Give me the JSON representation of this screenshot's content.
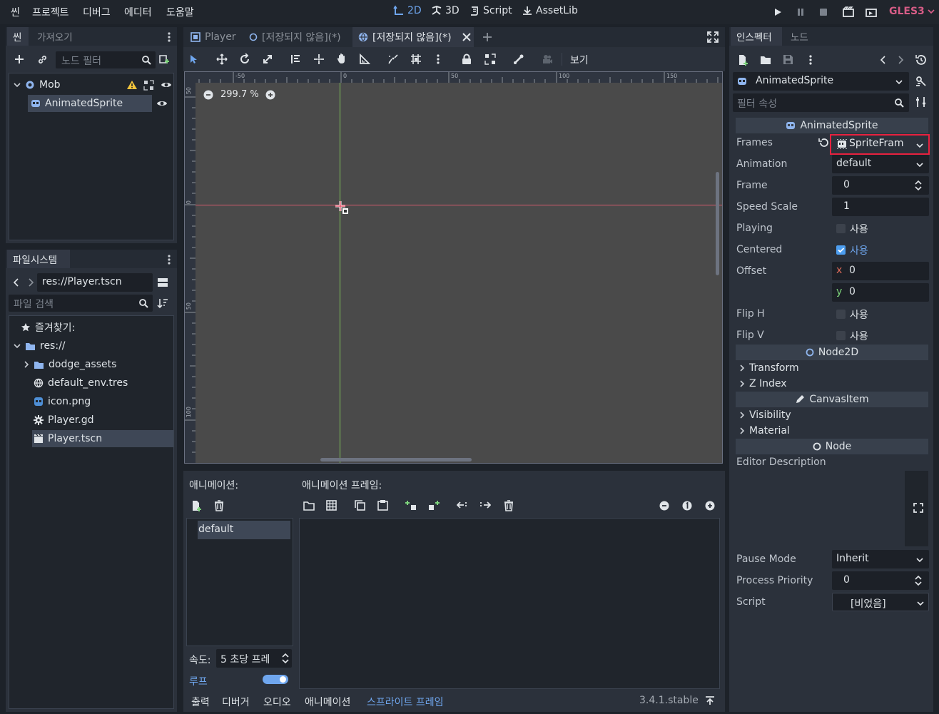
{
  "menu": [
    "씬",
    "프로젝트",
    "디버그",
    "에디터",
    "도움말"
  ],
  "workspaces": [
    {
      "label": "2D",
      "icon": "2d-icon"
    },
    {
      "label": "3D",
      "icon": "3d-icon"
    },
    {
      "label": "Script",
      "icon": "script-icon"
    },
    {
      "label": "AssetLib",
      "icon": "assetlib-icon"
    }
  ],
  "renderer": "GLES3",
  "scene_dock": {
    "tabs": [
      "씬",
      "가져오기"
    ],
    "filter_placeholder": "노드 필터",
    "tree": [
      {
        "label": "Mob",
        "icon": "node2d-icon"
      },
      {
        "label": "AnimatedSprite",
        "icon": "animated-sprite-icon"
      }
    ]
  },
  "filesystem": {
    "tab": "파일시스템",
    "path": "res://Player.tscn",
    "search_placeholder": "파일 검색",
    "favorites": "즐겨찾기:",
    "root": "res://",
    "items": [
      {
        "label": "dodge_assets",
        "icon": "folder-icon"
      },
      {
        "label": "default_env.tres",
        "icon": "environment-icon"
      },
      {
        "label": "icon.png",
        "icon": "image-icon"
      },
      {
        "label": "Player.gd",
        "icon": "gear-icon"
      },
      {
        "label": "Player.tscn",
        "icon": "scene-icon"
      }
    ]
  },
  "editor_tabs": [
    "Player",
    "[저장되지 않음](*)",
    "[저장되지 않음](*)"
  ],
  "toolbar": {
    "view_label": "보기"
  },
  "viewport": {
    "zoom": "299.7 %",
    "ruler_h": [
      "-50",
      "0",
      "50",
      "100",
      "150"
    ],
    "ruler_v": [
      "50",
      "0",
      "50",
      "100"
    ]
  },
  "sprite_frames_panel": {
    "animations_label": "애니메이션:",
    "frames_label": "애니메이션 프레임:",
    "animation_list": [
      "default"
    ],
    "speed_label": "속도:",
    "speed_value": "5 초당 프레",
    "loop_label": "루프",
    "loop_on": true
  },
  "bottom_tabs": [
    "출력",
    "디버거",
    "오디오",
    "애니메이션",
    "스프라이트 프레임"
  ],
  "version": "3.4.1.stable",
  "inspector": {
    "tabs": [
      "인스펙터",
      "노드"
    ],
    "object_name": "AnimatedSprite",
    "filter_placeholder": "필터 속성",
    "class_header": "AnimatedSprite",
    "properties": {
      "frames_label": "Frames",
      "frames_value": "SpriteFram",
      "animation_label": "Animation",
      "animation_value": "default",
      "frame_label": "Frame",
      "frame_value": "0",
      "speed_label": "Speed Scale",
      "speed_value": "1",
      "playing_label": "Playing",
      "playing_value": "사용",
      "centered_label": "Centered",
      "centered_value": "사용",
      "offset_label": "Offset",
      "offset_x_axis": "x",
      "offset_x": "0",
      "offset_y_axis": "y",
      "offset_y": "0",
      "fliph_label": "Flip H",
      "fliph_value": "사용",
      "flipv_label": "Flip V",
      "flipv_value": "사용"
    },
    "node2d_header": "Node2D",
    "transform": "Transform",
    "zindex": "Z Index",
    "canvasitem_header": "CanvasItem",
    "visibility": "Visibility",
    "material": "Material",
    "node_header": "Node",
    "editor_description": "Editor Description",
    "pause_label": "Pause Mode",
    "pause_value": "Inherit",
    "priority_label": "Process Priority",
    "priority_value": "0",
    "script_label": "Script",
    "script_value": "[비었음]"
  },
  "colors": {
    "accent": "#6fa6ee",
    "highlight_box": "#e8213f",
    "gles": "#d65c86",
    "warning": "#f3c53c"
  }
}
